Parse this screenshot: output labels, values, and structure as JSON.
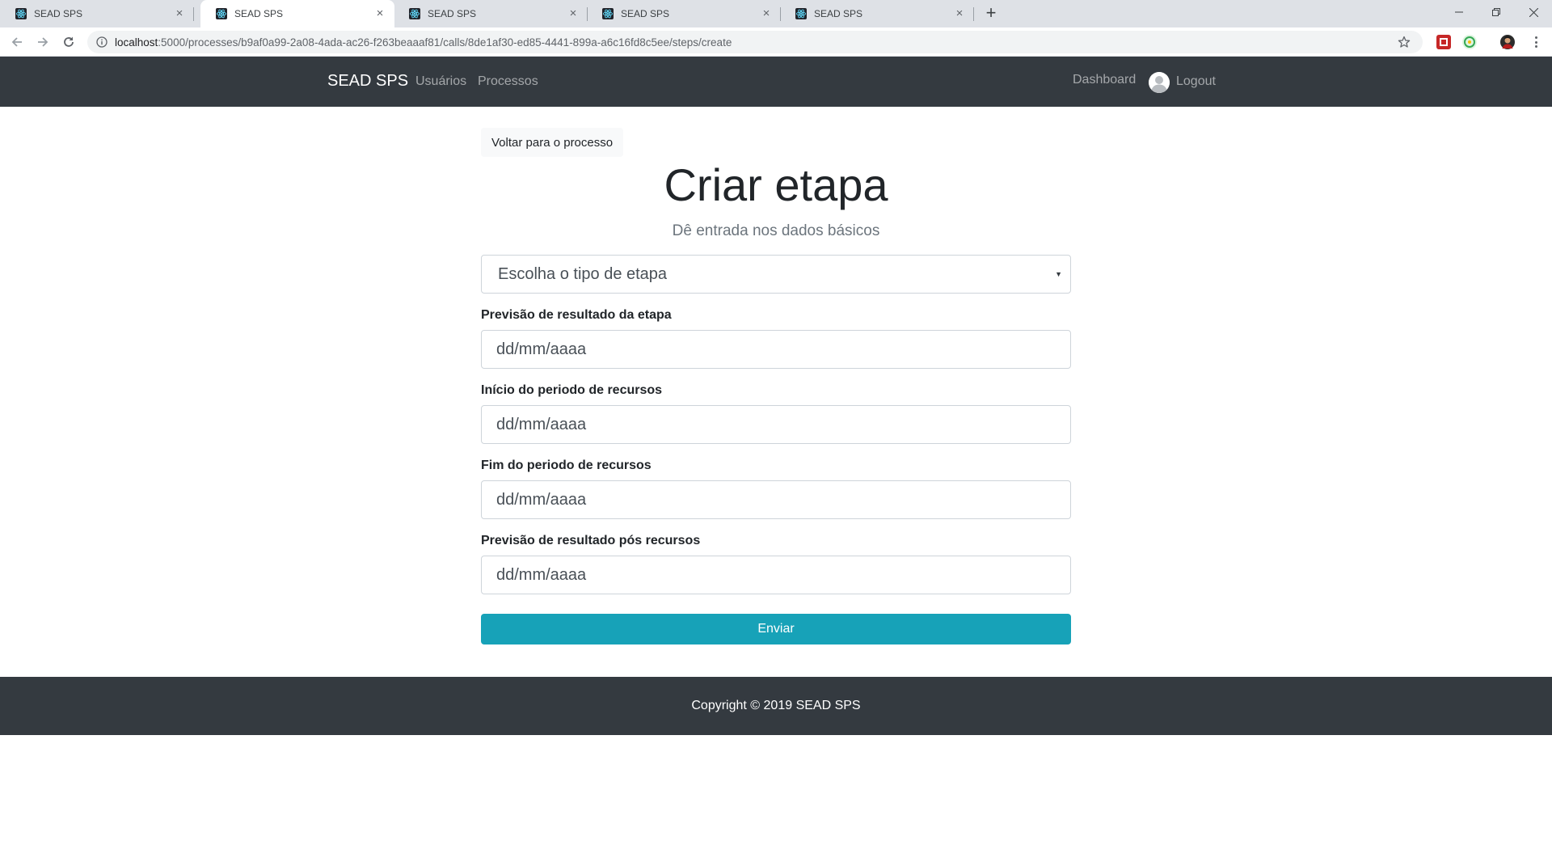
{
  "browser": {
    "tabs": [
      {
        "title": "SEAD SPS",
        "active": false
      },
      {
        "title": "SEAD SPS",
        "active": true
      },
      {
        "title": "SEAD SPS",
        "active": false
      },
      {
        "title": "SEAD SPS",
        "active": false
      },
      {
        "title": "SEAD SPS",
        "active": false
      }
    ],
    "tab_close_glyph": "×",
    "new_tab_glyph": "+",
    "url_host": "localhost",
    "url_path": ":5000/processes/b9af0a99-2a08-4ada-ac26-f263beaaaf81/calls/8de1af30-ed85-4441-899a-a6c16fd8c5ee/steps/create",
    "icons": {
      "favicon": "react-favicon-icon",
      "back": "arrow-left-icon",
      "forward": "arrow-right-icon",
      "reload": "reload-icon",
      "info": "info-icon",
      "bookmark": "star-icon",
      "menu": "kebab-menu-icon"
    }
  },
  "navbar": {
    "brand": "SEAD SPS",
    "links": [
      "Usuários",
      "Processos"
    ],
    "dashboard": "Dashboard",
    "logout": "Logout"
  },
  "main": {
    "back_button": "Voltar para o processo",
    "title": "Criar etapa",
    "subtitle": "Dê entrada nos dados básicos",
    "step_type_select": "Escolha o tipo de etapa",
    "fields": [
      {
        "label": "Previsão de resultado da etapa",
        "placeholder": "dd/mm/aaaa"
      },
      {
        "label": "Início do periodo de recursos",
        "placeholder": "dd/mm/aaaa"
      },
      {
        "label": "Fim do periodo de recursos",
        "placeholder": "dd/mm/aaaa"
      },
      {
        "label": "Previsão de resultado pós recursos",
        "placeholder": "dd/mm/aaaa"
      }
    ],
    "submit": "Enviar"
  },
  "footer": {
    "copyright": "Copyright © 2019 SEAD SPS"
  },
  "colors": {
    "navbar_bg": "#343a40",
    "accent": "#17a2b8",
    "tabstrip_bg": "#dee1e6"
  }
}
